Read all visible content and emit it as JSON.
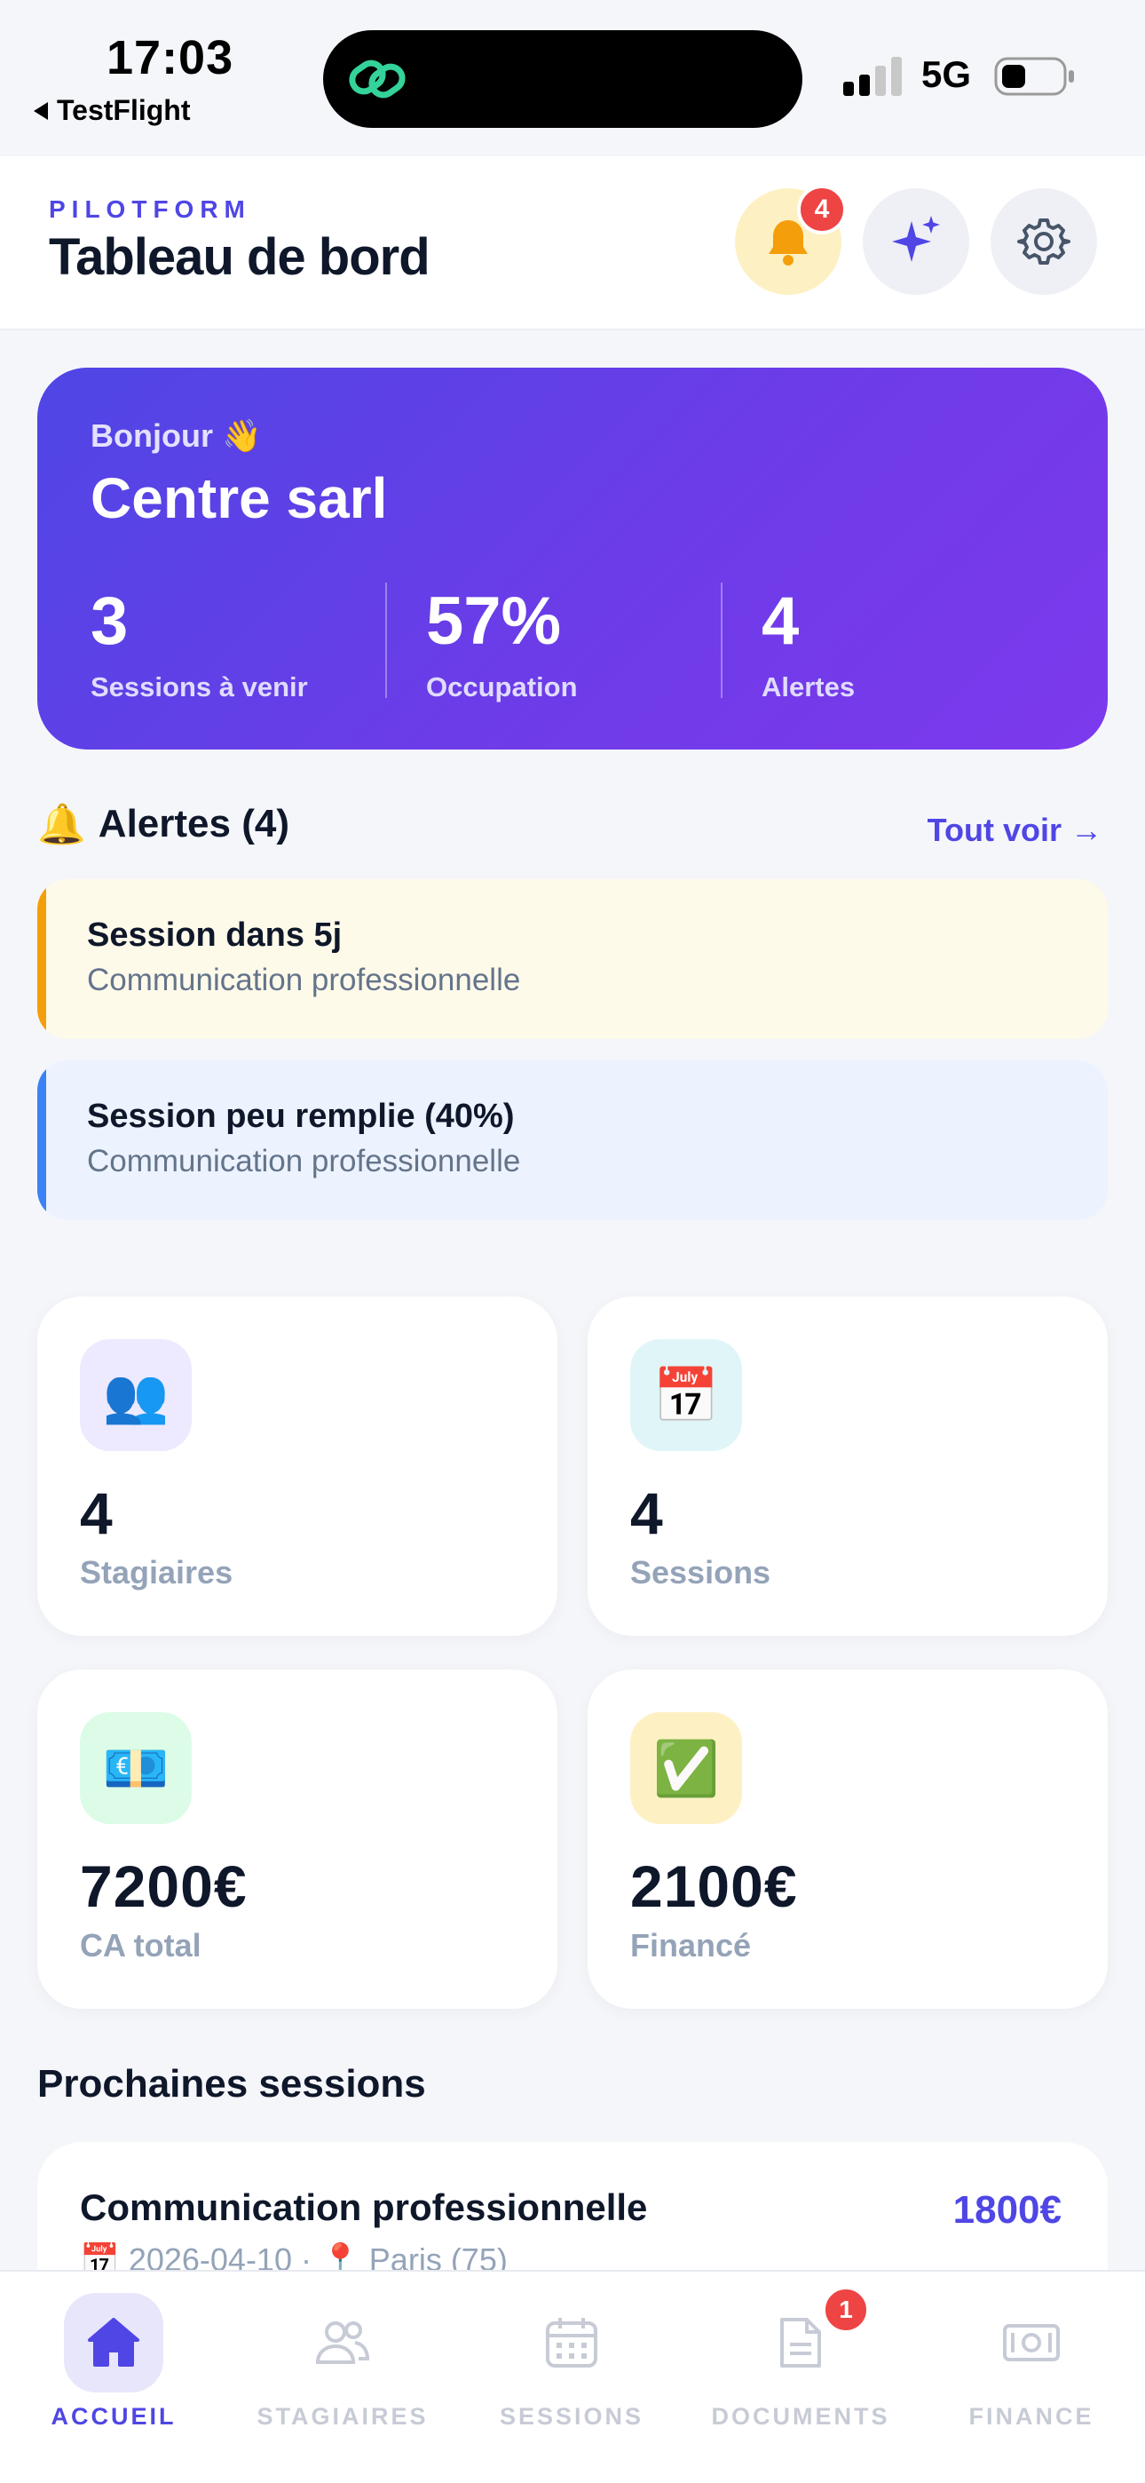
{
  "status_bar": {
    "time": "17:03",
    "back_app": "TestFlight",
    "network": "5G",
    "icons": [
      "chain-link-icon",
      "signal-icon",
      "battery-icon"
    ]
  },
  "header": {
    "brand": "PILOTFORM",
    "title": "Tableau de bord",
    "notification_count": "4",
    "icons": [
      "bell-icon",
      "sparkles-icon",
      "gear-icon"
    ]
  },
  "hero": {
    "greeting": "Bonjour 👋",
    "name": "Centre sarl",
    "stats": [
      {
        "value": "3",
        "label": "Sessions à venir"
      },
      {
        "value": "57%",
        "label": "Occupation"
      },
      {
        "value": "4",
        "label": "Alertes"
      }
    ]
  },
  "alerts": {
    "title": "Alertes (4)",
    "emoji": "🔔",
    "see_all": "Tout voir →",
    "items": [
      {
        "title": "Session dans 5j",
        "subtitle": "Communication professionnelle",
        "accent": "#f59e0b",
        "bg": "#fefaea"
      },
      {
        "title": "Session peu remplie (40%)",
        "subtitle": "Communication professionnelle",
        "accent": "#3b82f6",
        "bg": "#ecf3fe"
      }
    ]
  },
  "stats_cards": [
    {
      "emoji": "👥",
      "value": "4",
      "label": "Stagiaires",
      "icon_bg": "#ede9fe"
    },
    {
      "emoji": "📅",
      "value": "4",
      "label": "Sessions",
      "icon_bg": "#e0f5f7"
    },
    {
      "emoji": "💶",
      "value": "7200€",
      "label": "CA total",
      "icon_bg": "#dcfce7"
    },
    {
      "emoji": "✅",
      "value": "2100€",
      "label": "Financé",
      "icon_bg": "#fdf1c4"
    }
  ],
  "next_sessions": {
    "title": "Prochaines sessions",
    "items": [
      {
        "title": "Communication professionnelle",
        "price": "1800€",
        "meta": "📅 2026-04-10 · 📍 Paris (75)"
      }
    ]
  },
  "tabbar": {
    "tabs": [
      {
        "label": "ACCUEIL",
        "icon": "home-icon",
        "active": true
      },
      {
        "label": "STAGIAIRES",
        "icon": "users-icon",
        "active": false
      },
      {
        "label": "SESSIONS",
        "icon": "calendar-icon",
        "active": false
      },
      {
        "label": "DOCUMENTS",
        "icon": "document-icon",
        "active": false,
        "badge": "1"
      },
      {
        "label": "FINANCE",
        "icon": "banknote-icon",
        "active": false
      }
    ]
  },
  "colors": {
    "accent": "#4f46e5",
    "hero_gradient_start": "#4f46e5",
    "hero_gradient_end": "#7c3aed",
    "badge": "#ef4444",
    "inactive_tab": "#c7cbd6"
  }
}
